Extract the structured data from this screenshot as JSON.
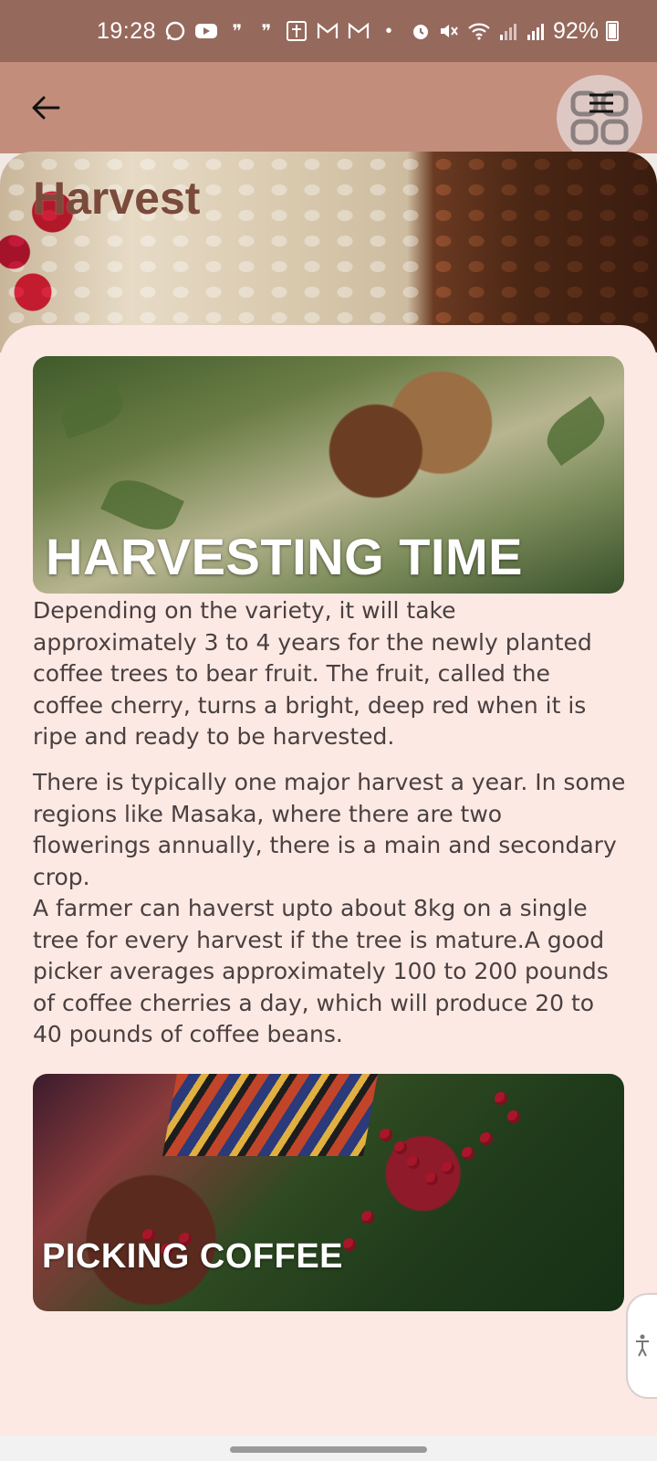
{
  "status_bar": {
    "time": "19:28",
    "battery": "92%",
    "icons": [
      "whatsapp-icon",
      "youtube-icon",
      "quote-icon",
      "quote-icon",
      "news-icon",
      "gmail-icon",
      "gmail-icon",
      "dot-icon",
      "alarm-icon",
      "mute-icon",
      "wifi-icon",
      "signal-icon",
      "signal-icon",
      "battery-icon"
    ]
  },
  "app_bar": {
    "back_icon": "arrow-left-icon",
    "menu_icon": "menu-icon"
  },
  "hero": {
    "title": "Harvest"
  },
  "cards": [
    {
      "label": "HARVESTING TIME"
    },
    {
      "label": "PICKING COFFEE"
    }
  ],
  "paragraphs": [
    "Depending on the variety, it will take approximately 3 to 4 years for the newly planted coffee trees to bear fruit. The fruit, called the coffee cherry, turns a bright, deep red when it is ripe and ready to be harvested.",
    "There is typically one major harvest a year. In some regions like Masaka, where there are two flowerings annually, there is a main and secondary crop.\nA farmer can haverst upto about 8kg on a single tree for every harvest if the tree is mature.A good picker averages approximately 100 to 200 pounds of coffee cherries a day, which will produce 20 to 40 pounds of coffee beans."
  ],
  "colors": {
    "status_bar": "#96695d",
    "app_bar": "#c38d7b",
    "sheet": "#fde9e4",
    "text": "#4a4040",
    "hero_title": "#7a4a3b"
  }
}
